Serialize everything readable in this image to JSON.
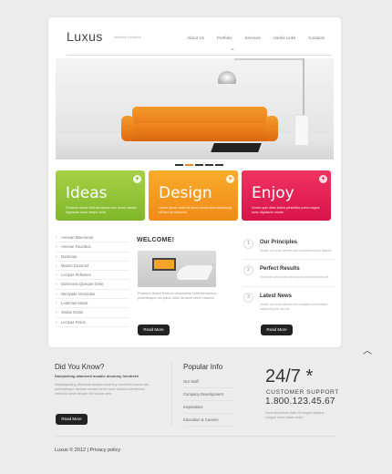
{
  "header": {
    "logo": "Luxus",
    "tagline": "creative furniture",
    "nav": [
      "About Us",
      "Portfolio",
      "Services",
      "Useful Links",
      "Contacts"
    ]
  },
  "slider": {
    "active_index": 1,
    "count": 5
  },
  "tiles": [
    {
      "title": "Ideas",
      "text": "Vivamus varius velit sed ipsum nec lorem mauris dignissim tortor neque amet",
      "color": "#8cc43a"
    },
    {
      "title": "Design",
      "text": "Lorem ipsum dolor sit amet consectetur adipiscing elit sed do eiusmod",
      "color": "#f59a21"
    },
    {
      "title": "Enjoy",
      "text": "Donec quis diam lectus phasellus porta magna nunc dignissim ornare",
      "color": "#e42553"
    }
  ],
  "sidebar_links": [
    "Aenean Maecenas",
    "Aenean Faucibus",
    "Duisimae",
    "Mauris Dictumst",
    "Lectyas Pellentes",
    "Duismosa Quisque Dolor",
    "Nectyade Vectorass",
    "Ledemas Maxis",
    "Sedan Dolas",
    "Lectyas Felios"
  ],
  "welcome": {
    "title": "WELCOME!",
    "text": "Praesent dictum rhoncus consectetur nulla elementum pellentesque nisl ipsum dolor sit amet lorem vivamus",
    "button": "Read More"
  },
  "info": [
    {
      "num": "1",
      "title": "Our Principles",
      "text": "Donec est urna ultrices sed sodales mauris lacinia."
    },
    {
      "num": "2",
      "title": "Perfect Results",
      "text": "Vivamus varius velit sed ipsum condimentum vel."
    },
    {
      "num": "3",
      "title": "Latest News",
      "text": "Donec est urna ultrices sed sodales consectetur adipiscing elit sed do."
    }
  ],
  "info_button": "Read More",
  "footer": {
    "did_you_know": {
      "title": "Did You Know?",
      "bold": "Dasipisking aliamenti anaalis doummy hendrerit",
      "text": "Nasadipisking aliamenti anaalis doummy hendrerit mauris fan pellentesque aenean ornare lorem nunc dictum elementum vehicula amet integer vel lacinia sem",
      "button": "Read More"
    },
    "popular": {
      "title": "Popular Info",
      "items": [
        "Our Staff",
        "Company Development",
        "Inspirations",
        "Education & Careers"
      ]
    },
    "support": {
      "big": "24/7 *",
      "label": "CUSTOMER SUPPORT",
      "phone": "1.800.123.45.67",
      "note": "Nunc accumsan dolor at magna dapibus congue lorem ipsum dolor"
    },
    "copyright": "Luxus © 2012  |  Privacy policy"
  }
}
